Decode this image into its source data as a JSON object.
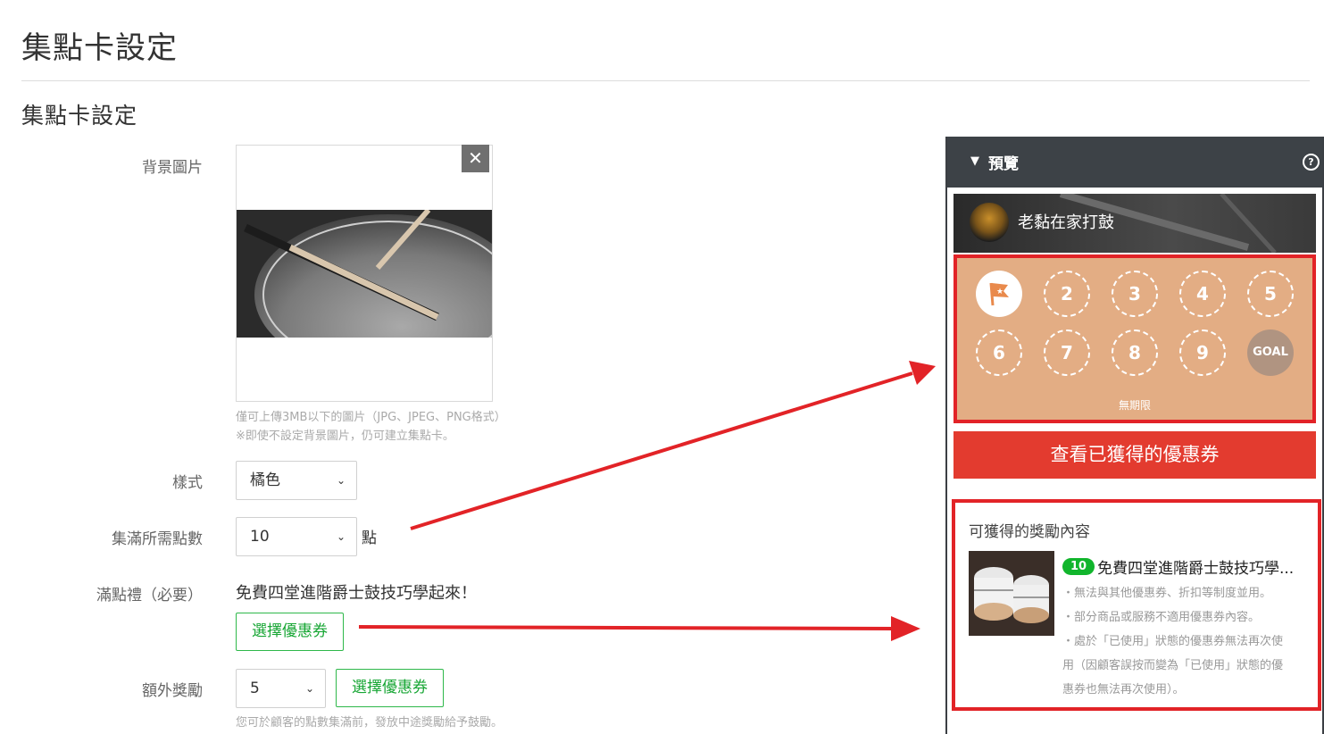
{
  "page": {
    "title": "集點卡設定",
    "section_title": "集點卡設定"
  },
  "form": {
    "background_label": "背景圖片",
    "close_symbol": "✕",
    "hint_upload": "僅可上傳3MB以下的圖片（JPG、JPEG、PNG格式）",
    "hint_optional": "※即使不設定背景圖片，仍可建立集點卡。",
    "style_label": "樣式",
    "style_value": "橘色",
    "points_label": "集滿所需點數",
    "points_value": "10",
    "points_unit": "點",
    "reward_label": "滿點禮（必要）",
    "reward_text": "免費四堂進階爵士鼓技巧學起來！",
    "select_coupon_label": "選擇優惠券",
    "extra_label": "額外獎勵",
    "extra_value": "5",
    "extra_hint": "您可於顧客的點數集滿前，發放中途獎勵給予鼓勵。"
  },
  "preview": {
    "header_title": "預覽",
    "help_symbol": "?",
    "card_name": "老黏在家打鼓",
    "stamps": [
      "2",
      "3",
      "4",
      "5",
      "6",
      "7",
      "8",
      "9"
    ],
    "goal_label": "GOAL",
    "validity": "無期限",
    "coupon_button": "查看已獲得的優惠券",
    "rewards_title": "可獲得的獎勵內容",
    "reward_points": "10",
    "reward_name": "免費四堂進階爵士鼓技巧學...",
    "notes": [
      "・無法與其他優惠券、折扣等制度並用。",
      "・部分商品或服務不適用優惠券內容。",
      "・處於「已使用」狀態的優惠券無法再次使",
      "用（因顧客誤按而變為「已使用」狀態的優",
      "惠券也無法再次使用）。"
    ]
  },
  "colors": {
    "accent_green": "#17a634",
    "stamp_orange": "#e3ad84",
    "highlight_red": "#e22327",
    "coupon_red": "#e33b2f",
    "preview_header": "#3d4247"
  }
}
